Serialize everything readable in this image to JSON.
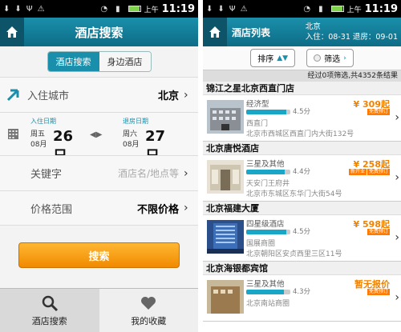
{
  "status_bar": {
    "ampm": "上午",
    "time": "11:19",
    "battery_level": 0.95
  },
  "screen1": {
    "title": "酒店搜索",
    "segments": [
      "酒店搜索",
      "身边酒店"
    ],
    "city_label": "入住城市",
    "city_value": "北京",
    "checkin": {
      "caption": "入住日期",
      "weekday": "周五",
      "month": "08月",
      "day": "26日"
    },
    "checkout": {
      "caption": "退房日期",
      "weekday": "周六",
      "month": "08月",
      "day": "27日"
    },
    "swap_symbol": "◀▶",
    "keyword_label": "关键字",
    "keyword_placeholder": "酒店名/地点等",
    "price_label": "价格范围",
    "price_value": "不限价格",
    "search_button": "搜索",
    "nav": [
      "酒店搜索",
      "我的收藏"
    ],
    "colors": {
      "accent": "#1a8fab",
      "button": "#f5a000"
    }
  },
  "screen2": {
    "title": "酒店列表",
    "city": "北京",
    "dates": "入住：08-31 退房：09-01",
    "sort_label": "排序",
    "filter_label": "筛选",
    "summary": "经过0项筛选,共4352条结果",
    "hotels": [
      {
        "name": "锦江之星北京西直门店",
        "type": "经济型",
        "rating": "4.5分",
        "rating_value": 4.5,
        "area": "西直门",
        "address": "北京市西城区西直门内大街132号",
        "price": "¥ 309起",
        "badges": [
          "免费预订"
        ]
      },
      {
        "name": "北京唐悦酒店",
        "type": "三星及其他",
        "rating": "4.4分",
        "rating_value": 4.4,
        "area": "天安门王府井",
        "address": "北京市东城区东华门大街54号",
        "price": "¥ 258起",
        "badges": [
          "新开业",
          "免费预订"
        ]
      },
      {
        "name": "北京福建大厦",
        "type": "四星级酒店",
        "rating": "4.5分",
        "rating_value": 4.5,
        "area": "国展商圈",
        "address": "北京朝阳区安贞西里三区11号",
        "price": "¥ 598起",
        "badges": [
          "免费预订"
        ]
      },
      {
        "name": "北京海银都宾馆",
        "type": "三星及其他",
        "rating": "4.3分",
        "rating_value": 4.3,
        "area": "北京南站商圈",
        "address": "",
        "price": "暂无报价",
        "badges": [
          "免费预订"
        ]
      }
    ]
  }
}
